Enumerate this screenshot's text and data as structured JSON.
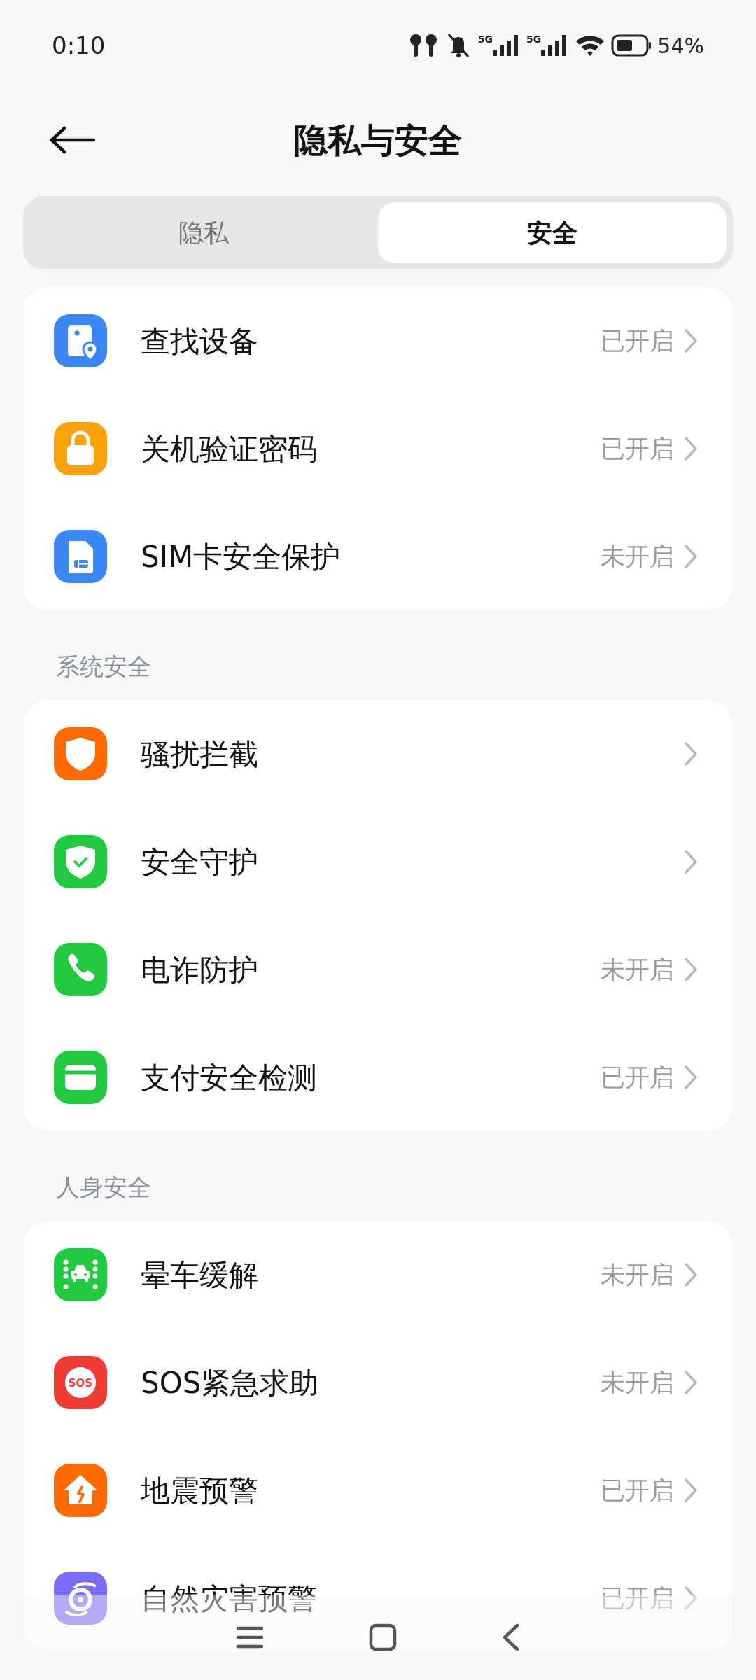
{
  "status_bar": {
    "time": "0:10",
    "networks": [
      "5G",
      "5G"
    ],
    "battery": "54%"
  },
  "header": {
    "title": "隐私与安全"
  },
  "tabs": [
    {
      "label": "隐私",
      "selected": false
    },
    {
      "label": "安全",
      "selected": true
    }
  ],
  "groups": [
    {
      "items": [
        {
          "label": "查找设备",
          "status": "已开启"
        },
        {
          "label": "关机验证密码",
          "status": "已开启"
        },
        {
          "label": "SIM卡安全保护",
          "status": "未开启"
        }
      ]
    },
    {
      "title": "系统安全",
      "items": [
        {
          "label": "骚扰拦截"
        },
        {
          "label": "安全守护"
        },
        {
          "label": "电诈防护",
          "status": "未开启"
        },
        {
          "label": "支付安全检测",
          "status": "已开启"
        }
      ]
    },
    {
      "title": "人身安全",
      "items": [
        {
          "label": "晕车缓解",
          "status": "未开启"
        },
        {
          "label": "SOS紧急求助",
          "icon_text": "SOS",
          "status": "未开启"
        },
        {
          "label": "地震预警",
          "status": "已开启"
        },
        {
          "label": "自然灾害预警",
          "status": "已开启"
        }
      ]
    }
  ]
}
